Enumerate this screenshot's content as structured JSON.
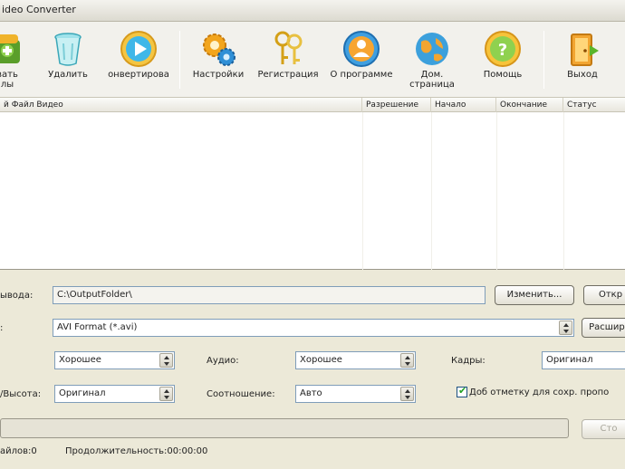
{
  "window": {
    "title": "ideo Converter"
  },
  "toolbar": {
    "buttons": [
      {
        "label": "вать\nлы",
        "icon": "add-files-icon"
      },
      {
        "label": "Удалить",
        "icon": "trash-icon"
      },
      {
        "label": "онвертирова",
        "icon": "convert-play-icon"
      },
      {
        "label": "Настройки",
        "icon": "gears-icon"
      },
      {
        "label": "Регистрация",
        "icon": "keys-icon"
      },
      {
        "label": "О программе",
        "icon": "user-about-icon"
      },
      {
        "label": "Дом.\nстраница",
        "icon": "globe-home-icon"
      },
      {
        "label": "Помощь",
        "icon": "help-icon"
      },
      {
        "label": "Выход",
        "icon": "exit-door-icon"
      }
    ]
  },
  "file_list": {
    "columns": [
      "й Файл Видео",
      "Разрешение",
      "Начало",
      "Окончание",
      "Статус"
    ],
    "rows": []
  },
  "settings": {
    "output_label": "ывода:",
    "output_path": "C:\\OutputFolder\\",
    "change_button": "Изменить...",
    "open_button": "Откр",
    "format_label": ":",
    "format_value": "AVI Format (*.avi)",
    "advanced_button": "Расшире",
    "quality_value": "Хорошее",
    "audio_label": "Аудио:",
    "audio_value": "Хорошее",
    "frames_label": "Кадры:",
    "frames_value": "Оригинал",
    "size_label": "/Высота:",
    "size_value": "Оригинал",
    "ratio_label": "Соотношение:",
    "ratio_value": "Авто",
    "keep_checkbox_label": "Доб отметку для сохр. пропо",
    "keep_checkbox_checked": true,
    "stop_button": "Сто"
  },
  "status": {
    "files": "айлов:0",
    "duration": "Продолжительность:00:00:00"
  }
}
